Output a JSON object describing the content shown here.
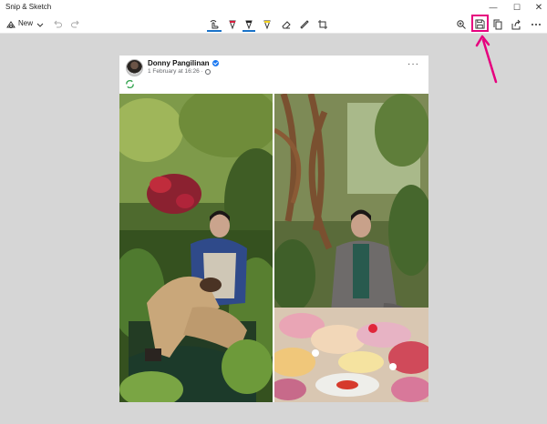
{
  "app": {
    "title": "Snip & Sketch"
  },
  "window_controls": {
    "minimize": "—",
    "maximize": "☐",
    "close": "✕"
  },
  "toolbar": {
    "new_label": "New",
    "tools": [
      "touch-writing",
      "ballpoint-pen",
      "pencil",
      "highlighter",
      "eraser",
      "ruler",
      "crop"
    ],
    "right_tools": [
      "zoom",
      "save-as",
      "copy",
      "share",
      "see-more"
    ]
  },
  "post": {
    "author": "Donny Pangilinan",
    "time": "1 February at 16:26 ·",
    "more": "···"
  },
  "colors": {
    "accent": "#1a73c9",
    "highlight": "#e6007e",
    "verified": "#1877f2"
  }
}
